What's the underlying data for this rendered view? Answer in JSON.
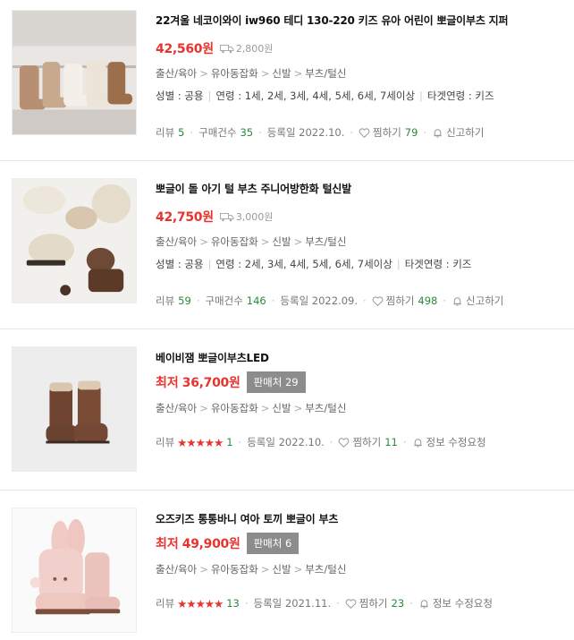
{
  "items": [
    {
      "title": "22겨울 네코이와이 iw960 테디 130-220 키즈 유아 어린이 뽀글이부츠 지퍼",
      "price": "42,560원",
      "shipping": "2,800원",
      "category": [
        "출산/육아",
        "유아동잡화",
        "신발",
        "부츠/털신"
      ],
      "spec": [
        "성별 : 공용",
        "연령 : 1세, 2세, 3세, 4세, 5세, 6세, 7세이상",
        "타겟연령 : 키즈"
      ],
      "review_label": "리뷰",
      "review_count": "5",
      "purchase_label": "구매건수",
      "purchase_count": "35",
      "date": "등록일 2022.10.",
      "wish_label": "찜하기",
      "wish_count": "79",
      "action_label": "신고하기"
    },
    {
      "title": "뽀글이 돌 아기 털 부츠 주니어방한화 털신발",
      "price": "42,750원",
      "shipping": "3,000원",
      "category": [
        "출산/육아",
        "유아동잡화",
        "신발",
        "부츠/털신"
      ],
      "spec": [
        "성별 : 공용",
        "연령 : 2세, 3세, 4세, 5세, 6세, 7세이상",
        "타겟연령 : 키즈"
      ],
      "review_label": "리뷰",
      "review_count": "59",
      "purchase_label": "구매건수",
      "purchase_count": "146",
      "date": "등록일 2022.09.",
      "wish_label": "찜하기",
      "wish_count": "498",
      "action_label": "신고하기"
    },
    {
      "title": "베이비잼 뽀글이부츠LED",
      "price_prefix": "최저",
      "price": "36,700원",
      "sellers": "판매처 29",
      "category": [
        "출산/육아",
        "유아동잡화",
        "신발",
        "부츠/털신"
      ],
      "review_label": "리뷰",
      "stars": "★★★★★",
      "review_count": "1",
      "date": "등록일 2022.10.",
      "wish_label": "찜하기",
      "wish_count": "11",
      "action_label": "정보 수정요청"
    },
    {
      "title": "오즈키즈 통통바니 여아 토끼 뽀글이 부츠",
      "price_prefix": "최저",
      "price": "49,900원",
      "sellers": "판매처 6",
      "category": [
        "출산/육아",
        "유아동잡화",
        "신발",
        "부츠/털신"
      ],
      "review_label": "리뷰",
      "stars": "★★★★★",
      "review_count": "13",
      "date": "등록일 2021.11.",
      "wish_label": "찜하기",
      "wish_count": "23",
      "action_label": "정보 수정요청"
    }
  ],
  "colors": {
    "price": "#e8332e",
    "count": "#2a8a3e",
    "badge": "#8c8c8c"
  }
}
